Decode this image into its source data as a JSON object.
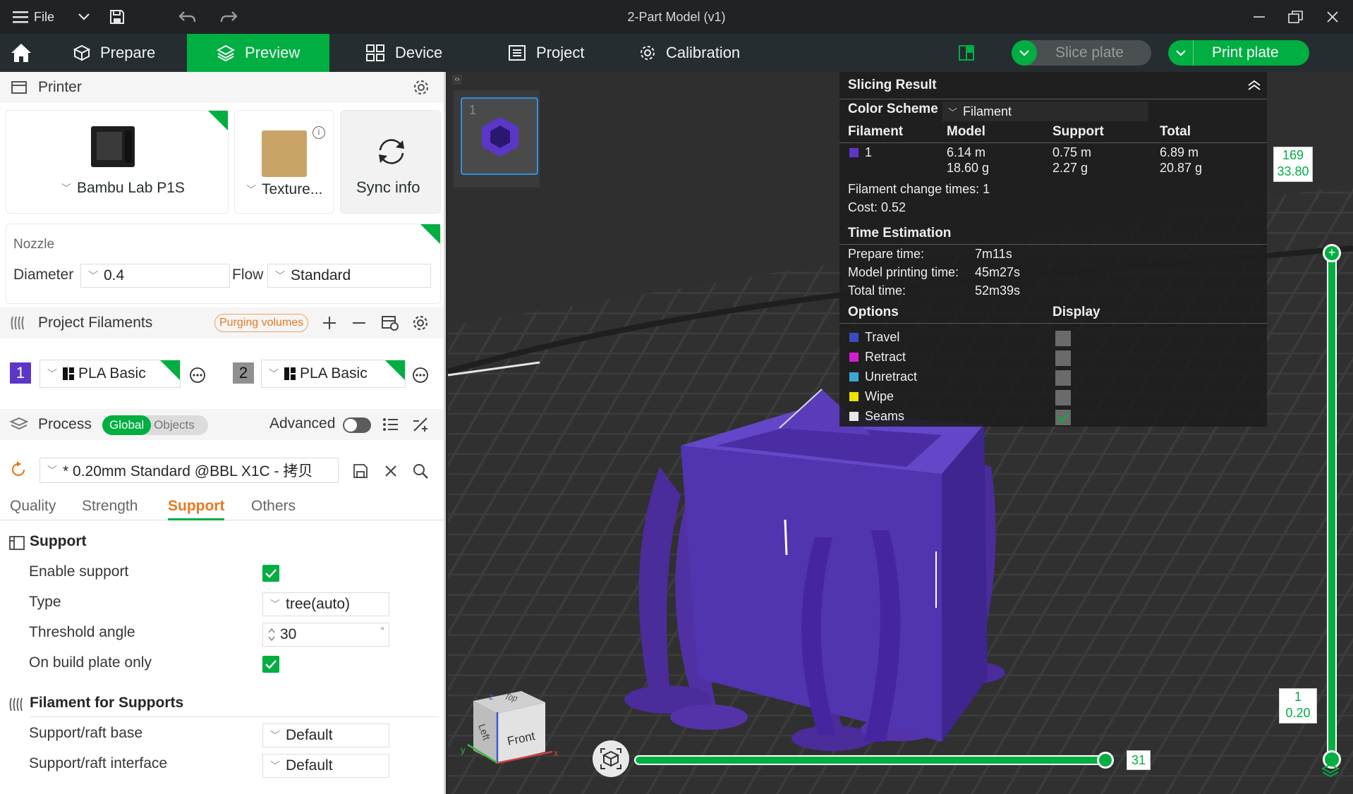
{
  "titlebar": {
    "menu_label": "File",
    "title": "2-Part Model (v1)"
  },
  "nav": {
    "tabs": [
      {
        "label": "Prepare"
      },
      {
        "label": "Preview",
        "active": true
      },
      {
        "label": "Device"
      },
      {
        "label": "Project"
      },
      {
        "label": "Calibration"
      }
    ],
    "slice_plate": "Slice plate",
    "print_plate": "Print plate",
    "accent_color": "#00ae42"
  },
  "printer": {
    "section_title": "Printer",
    "printer_name": "Bambu Lab P1S",
    "plate_name": "Texture...",
    "sync_label": "Sync info"
  },
  "nozzle": {
    "title": "Nozzle",
    "diameter_label": "Diameter",
    "diameter_value": "0.4",
    "flow_label": "Flow",
    "flow_value": "Standard"
  },
  "filaments": {
    "section_title": "Project Filaments",
    "purging_label": "Purging volumes",
    "items": [
      {
        "index": "1",
        "name": "PLA Basic",
        "color": "#5b37c8"
      },
      {
        "index": "2",
        "name": "PLA Basic",
        "color": "#909090"
      }
    ]
  },
  "process": {
    "section_title": "Process",
    "toggle_global": "Global",
    "toggle_objects": "Objects",
    "advanced_label": "Advanced",
    "advanced_on": false,
    "preset": "* 0.20mm Standard @BBL X1C - 拷贝",
    "tabs": [
      "Quality",
      "Strength",
      "Support",
      "Others"
    ],
    "active_tab": "Support"
  },
  "support": {
    "group_title": "Support",
    "enable_label": "Enable support",
    "enable_checked": true,
    "type_label": "Type",
    "type_value": "tree(auto)",
    "threshold_label": "Threshold angle",
    "threshold_value": "30",
    "threshold_unit": "°",
    "buildplate_label": "On build plate only",
    "buildplate_checked": true
  },
  "filament_supports": {
    "group_title": "Filament for Supports",
    "base_label": "Support/raft base",
    "base_value": "Default",
    "interface_label": "Support/raft interface",
    "interface_value": "Default"
  },
  "plate_thumb": {
    "number": "1"
  },
  "slicing": {
    "title": "Slicing Result",
    "color_scheme_label": "Color Scheme",
    "color_scheme_value": "Filament",
    "headers": {
      "filament": "Filament",
      "model": "Model",
      "support": "Support",
      "total": "Total"
    },
    "rows": [
      {
        "id": "1",
        "color": "#5b37c8",
        "model_len": "6.14 m",
        "model_wt": "18.60 g",
        "support_len": "0.75 m",
        "support_wt": "2.27 g",
        "total_len": "6.89 m",
        "total_wt": "20.87 g"
      }
    ],
    "change_times": "Filament change times:  1",
    "cost": "Cost:  0.52",
    "time_title": "Time Estimation",
    "prepare_label": "Prepare time:",
    "prepare_value": "7m11s",
    "model_time_label": "Model printing time:",
    "model_time_value": "45m27s",
    "total_time_label": "Total time:",
    "total_time_value": "52m39s",
    "options_label": "Options",
    "display_label": "Display",
    "options": [
      {
        "name": "Travel",
        "color": "#3a4cc0",
        "checked": false
      },
      {
        "name": "Retract",
        "color": "#d21ed2",
        "checked": false
      },
      {
        "name": "Unretract",
        "color": "#38a8d8",
        "checked": false
      },
      {
        "name": "Wipe",
        "color": "#f0e000",
        "checked": false
      },
      {
        "name": "Seams",
        "color": "#e6e6e6",
        "checked": true
      }
    ]
  },
  "layer_slider": {
    "top_layer": "169",
    "top_height": "33.80",
    "bottom_layer": "1",
    "bottom_height": "0.20"
  },
  "move_slider": {
    "value": "31",
    "fraction": 1.0
  },
  "view_cube": {
    "top": "Top",
    "left": "Left",
    "front": "Front",
    "axis_x": "x",
    "axis_y": "y",
    "axis_z": "z"
  }
}
